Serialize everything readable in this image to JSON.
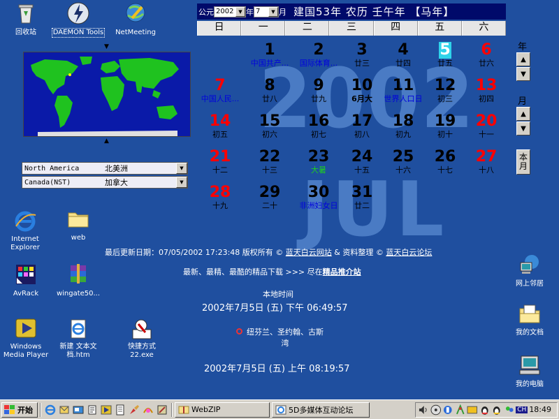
{
  "desktop_icons": {
    "recycle_bin": "回收站",
    "daemon_tools": "DAEMON Tools",
    "netmeeting": "NetMeeting",
    "internet_explorer": "Internet\nExplorer",
    "web": "web",
    "avrack": "AvRack",
    "wingate": "wingate50...",
    "windows_media_player": "Windows\nMedia Player",
    "new_text_doc": "新建 文本文\n档.htm",
    "shortcut": "快捷方式\n22.exe",
    "network_neighborhood": "网上邻居",
    "my_documents": "我的文档",
    "my_computer": "我的电脑"
  },
  "region": {
    "continent_en": "North America",
    "continent_zh": "北美洲",
    "zone_en": "Canada(NST)",
    "zone_zh": "加拿大"
  },
  "calendar": {
    "era_label": "公元",
    "year_value": "2002",
    "year_label": "年",
    "month_value": "7",
    "month_label": "月",
    "lunar_header": "建国53年  农历  壬午年  【马年】",
    "weekdays": [
      "日",
      "一",
      "二",
      "三",
      "四",
      "五",
      "六"
    ],
    "bg_year": "2002",
    "bg_month": "JUL",
    "days": [
      {
        "n": "1",
        "sub": "中国共产..."
      },
      {
        "n": "2",
        "sub": "国际体育..."
      },
      {
        "n": "3",
        "sub": "廿三"
      },
      {
        "n": "4",
        "sub": "廿四"
      },
      {
        "n": "5",
        "sub": "廿五"
      },
      {
        "n": "6",
        "sub": "廿六"
      },
      {
        "n": "7",
        "sub": "中国人民..."
      },
      {
        "n": "8",
        "sub": "廿八"
      },
      {
        "n": "9",
        "sub": "廿九"
      },
      {
        "n": "10",
        "sub": "6月大"
      },
      {
        "n": "11",
        "sub": "世界人口日"
      },
      {
        "n": "12",
        "sub": "初三"
      },
      {
        "n": "13",
        "sub": "初四"
      },
      {
        "n": "14",
        "sub": "初五"
      },
      {
        "n": "15",
        "sub": "初六"
      },
      {
        "n": "16",
        "sub": "初七"
      },
      {
        "n": "17",
        "sub": "初八"
      },
      {
        "n": "18",
        "sub": "初九"
      },
      {
        "n": "19",
        "sub": "初十"
      },
      {
        "n": "20",
        "sub": "十一"
      },
      {
        "n": "21",
        "sub": "十二"
      },
      {
        "n": "22",
        "sub": "十三"
      },
      {
        "n": "23",
        "sub": "大暑"
      },
      {
        "n": "24",
        "sub": "十五"
      },
      {
        "n": "25",
        "sub": "十六"
      },
      {
        "n": "26",
        "sub": "十七"
      },
      {
        "n": "27",
        "sub": "十八"
      },
      {
        "n": "28",
        "sub": "十九"
      },
      {
        "n": "29",
        "sub": "二十"
      },
      {
        "n": "30",
        "sub": "非洲妇女日"
      },
      {
        "n": "31",
        "sub": "廿二"
      }
    ],
    "year_label_right": "年",
    "month_label_right": "月",
    "this_month_btn": "本\n月"
  },
  "footer": {
    "update_prefix": "最后更新日期：07/05/2002 17:23:48 版权所有 ©",
    "site_link": "蓝天白云网站",
    "mid": "& 资料整理 ©",
    "forum_link": "蓝天白云论坛",
    "promo_prefix": "最新、最精、最酷的精品下载 >>> 尽在",
    "promo_link": "精品推介站",
    "local_time_label": "本地时间",
    "local_time": "2002年7月5日  (五) 下午  06:49:57",
    "remote_location": "纽芬兰、圣约翰、古斯\n湾",
    "remote_time": "2002年7月5日  (五) 上午  08:19:57"
  },
  "taskbar": {
    "start": "开始",
    "task1": "WebZIP",
    "task2": "5D多媒体互动论坛",
    "tray_lang": "CH",
    "clock": "18:49"
  }
}
